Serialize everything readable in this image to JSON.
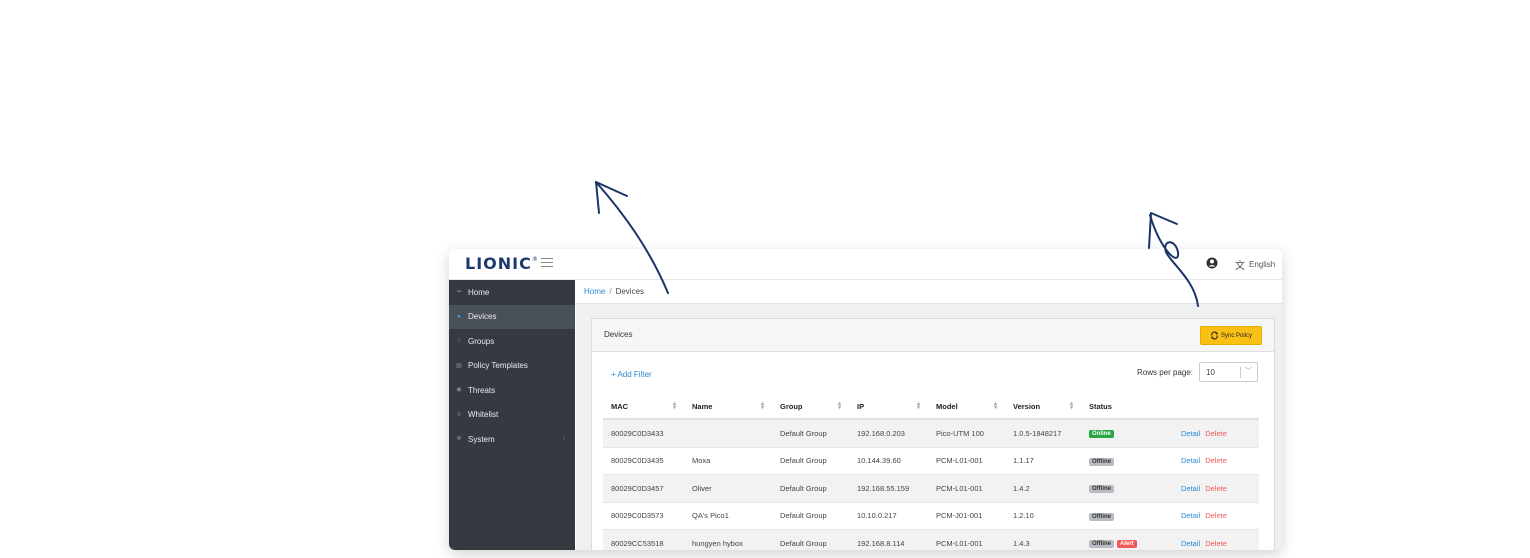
{
  "app": {
    "logo_text": "LIONIC",
    "logo_mark": "®",
    "language": "English"
  },
  "sidebar": {
    "items": [
      {
        "label": "Home",
        "icon": "dashboard-icon",
        "active": false
      },
      {
        "label": "Devices",
        "icon": "cloud-icon",
        "active": true
      },
      {
        "label": "Groups",
        "icon": "circle-icon",
        "active": false
      },
      {
        "label": "Policy Templates",
        "icon": "document-icon",
        "active": false
      },
      {
        "label": "Threats",
        "icon": "shield-icon",
        "active": false
      },
      {
        "label": "Whitelist",
        "icon": "list-icon",
        "active": false
      },
      {
        "label": "System",
        "icon": "gear-icon",
        "active": false,
        "chevron": "‹"
      }
    ]
  },
  "breadcrumb": {
    "home": "Home",
    "separator": "/",
    "current": "Devices"
  },
  "card": {
    "title": "Devices",
    "sync_label": "Sync Policy",
    "add_filter": "Add Filter",
    "rows_per_page_label": "Rows per page:",
    "rows_per_page_value": "10"
  },
  "table": {
    "headers": [
      "MAC",
      "Name",
      "Group",
      "IP",
      "Model",
      "Version",
      "Status"
    ],
    "rows": [
      {
        "mac": "80029C0D3433",
        "name": "",
        "group": "Default Group",
        "ip": "192.168.0.203",
        "model": "Pico-UTM 100",
        "version": "1.0.5-1848217",
        "status": "Online",
        "alert": ""
      },
      {
        "mac": "80029C0D3435",
        "name": "Moxa",
        "group": "Default Group",
        "ip": "10.144.39.60",
        "model": "PCM-L01-001",
        "version": "1.1.17",
        "status": "Offline",
        "alert": ""
      },
      {
        "mac": "80029C0D3457",
        "name": "Oliver",
        "group": "Default Group",
        "ip": "192.168.55.159",
        "model": "PCM-L01-001",
        "version": "1.4.2",
        "status": "Offline",
        "alert": ""
      },
      {
        "mac": "80029C0D3573",
        "name": "QA's Pico1",
        "group": "Default Group",
        "ip": "10.10.0.217",
        "model": "PCM-J01-001",
        "version": "1.2.10",
        "status": "Offline",
        "alert": ""
      },
      {
        "mac": "80029CC53518",
        "name": "hungyen hybox",
        "group": "Default Group",
        "ip": "192.168.8.114",
        "model": "PCM-L01-001",
        "version": "1.4.3",
        "status": "Offline",
        "alert": "Alert"
      }
    ],
    "detail_label": "Detail",
    "delete_label": "Delete"
  },
  "colors": {
    "accent": "#2a8ad4",
    "sidebar_bg": "#343a40",
    "sync_button": "#f9c015",
    "delete": "#f05a5a",
    "online": "#28a745",
    "annotation": "#1a3466"
  }
}
